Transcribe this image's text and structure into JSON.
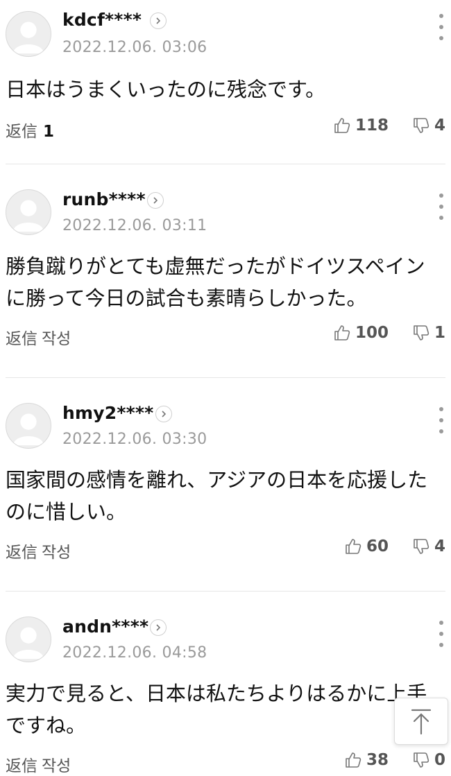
{
  "comments": [
    {
      "user": "kdcf****",
      "date": "2022.12.06. 03:06",
      "text": "日本はうまくいったのに残念です。",
      "reply_label": "返信",
      "reply_count": "1",
      "reply_write": "",
      "likes": "118",
      "dislikes": "4"
    },
    {
      "user": "runb****",
      "date": "2022.12.06. 03:11",
      "text": "勝負蹴りがとても虚無だったがドイツスペインに勝って今日の試合も素晴らしかった。",
      "reply_label": "返信",
      "reply_count": "",
      "reply_write": "작성",
      "likes": "100",
      "dislikes": "1"
    },
    {
      "user": "hmy2****",
      "date": "2022.12.06. 03:30",
      "text": "国家間の感情を離れ、アジアの日本を応援したのに惜しい。",
      "reply_label": "返信",
      "reply_count": "",
      "reply_write": "작성",
      "likes": "60",
      "dislikes": "4"
    },
    {
      "user": "andn****",
      "date": "2022.12.06. 04:58",
      "text": "実力で見ると、日本は私たちよりはるかに上手ですね。",
      "reply_label": "返信",
      "reply_count": "",
      "reply_write": "작성",
      "likes": "38",
      "dislikes": "0"
    }
  ],
  "icons": {
    "avatar": "avatar-placeholder-icon",
    "profile": "chevron-right-icon",
    "more": "more-vertical-icon",
    "like": "thumbs-up-icon",
    "dislike": "thumbs-down-icon",
    "scroll_top": "arrow-up-icon"
  }
}
